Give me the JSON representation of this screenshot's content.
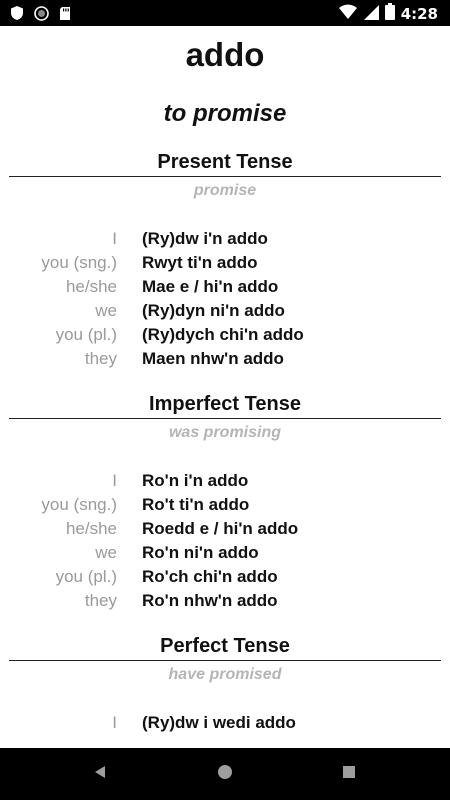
{
  "status_bar": {
    "time": "4:28"
  },
  "verb": {
    "title": "addo",
    "meaning": "to promise"
  },
  "sections": [
    {
      "title": "Present Tense",
      "subtitle": "promise",
      "rows": [
        {
          "pronoun": "I",
          "form": "(Ry)dw i'n addo"
        },
        {
          "pronoun": "you (sng.)",
          "form": "Rwyt ti'n addo"
        },
        {
          "pronoun": "he/she",
          "form": "Mae e / hi'n addo"
        },
        {
          "pronoun": "we",
          "form": "(Ry)dyn ni'n addo"
        },
        {
          "pronoun": "you (pl.)",
          "form": "(Ry)dych chi'n addo"
        },
        {
          "pronoun": "they",
          "form": "Maen nhw'n addo"
        }
      ]
    },
    {
      "title": "Imperfect Tense",
      "subtitle": "was promising",
      "rows": [
        {
          "pronoun": "I",
          "form": "Ro'n i'n addo"
        },
        {
          "pronoun": "you (sng.)",
          "form": "Ro't ti'n addo"
        },
        {
          "pronoun": "he/she",
          "form": "Roedd e / hi'n addo"
        },
        {
          "pronoun": "we",
          "form": "Ro'n ni'n addo"
        },
        {
          "pronoun": "you (pl.)",
          "form": "Ro'ch chi'n addo"
        },
        {
          "pronoun": "they",
          "form": "Ro'n nhw'n addo"
        }
      ]
    },
    {
      "title": "Perfect Tense",
      "subtitle": "have promised",
      "rows": [
        {
          "pronoun": "I",
          "form": "(Ry)dw i wedi addo"
        }
      ]
    }
  ],
  "nav": {
    "back": "back-icon",
    "home": "home-icon",
    "recents": "recents-icon"
  },
  "colors": {
    "status_bar": "#000000",
    "pronoun": "#9a9a9a",
    "subtitle": "#b5b5b5",
    "text": "#111111"
  }
}
